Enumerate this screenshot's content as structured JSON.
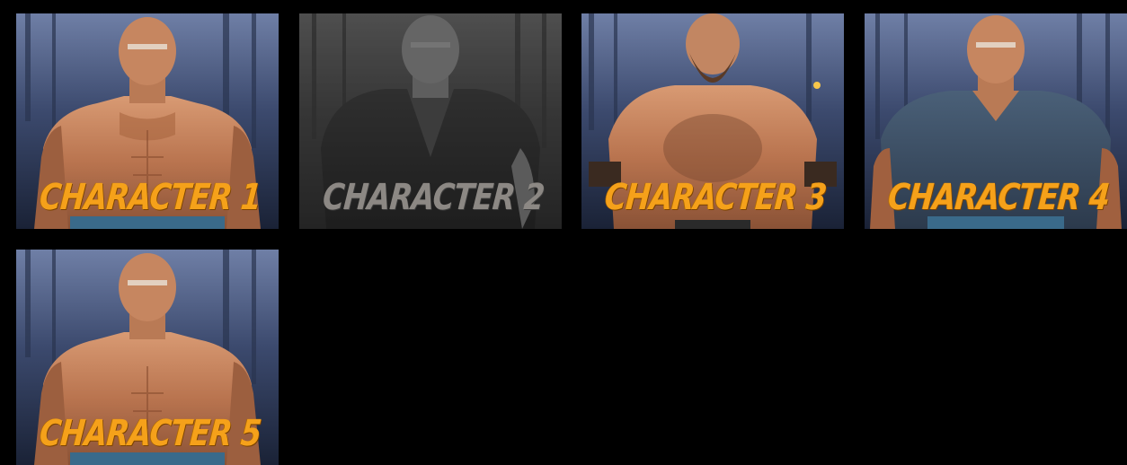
{
  "characters": [
    {
      "label": "CHARACTER 1",
      "state": "unlocked",
      "outfit": "shirtless"
    },
    {
      "label": "CHARACTER 2",
      "state": "locked",
      "outfit": "leather-jacket"
    },
    {
      "label": "CHARACTER 3",
      "state": "unlocked",
      "outfit": "bearded-shirtless"
    },
    {
      "label": "CHARACTER 4",
      "state": "unlocked",
      "outfit": "blue-shirt"
    },
    {
      "label": "CHARACTER 5",
      "state": "unlocked",
      "outfit": "shirtless"
    }
  ],
  "colors": {
    "background": "#000000",
    "label_active": "#f5a11a",
    "label_locked": "#8c8884"
  }
}
